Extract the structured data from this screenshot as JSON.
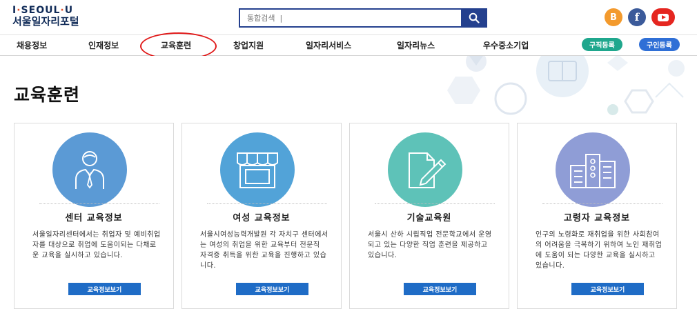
{
  "logo": {
    "line1_a": "I",
    "line1_dot1": "·",
    "line1_b": "SEOUL",
    "line1_dot2": "·",
    "line1_c": "U",
    "line2": "서울일자리포털"
  },
  "search": {
    "placeholder": "통합검색  |"
  },
  "social": {
    "blog_label": "B",
    "facebook_label": "f"
  },
  "nav": {
    "items": [
      "채용정보",
      "인재정보",
      "교육훈련",
      "창업지원",
      "일자리서비스",
      "일자리뉴스",
      "우수중소기업"
    ],
    "job_register": "구직등록",
    "hire_register": "구인등록"
  },
  "page_title": "교육훈련",
  "colors": {
    "brand_blue": "#24408e",
    "button_blue": "#1f6cc6",
    "highlight_red": "#e01a1a"
  },
  "cards": [
    {
      "title": "센터 교육정보",
      "desc": "서울일자리센터에서는 취업자 및 예비취업자를 대상으로 취업에 도움이되는 다채로운 교육을 실시하고 있습니다.",
      "button": "교육정보보기",
      "icon": "person-icon",
      "color": "#5b9ad5"
    },
    {
      "title": "여성 교육정보",
      "desc": "서울시여성능력개발원 각 자치구 센터에서는 여성의 취업을 위한 교육부터 전문직 자격증 취득을 위한 교육을 진행하고 있습니다.",
      "button": "교육정보보기",
      "icon": "shop-icon",
      "color": "#52a3d8"
    },
    {
      "title": "기술교육원",
      "desc": "서울시 산하 시립직업 전문학교에서 운영되고 있는 다양한 직업 훈련을 제공하고 있습니다.",
      "button": "교육정보보기",
      "icon": "document-pen-icon",
      "color": "#5ec2b8"
    },
    {
      "title": "고령자 교육정보",
      "desc": "인구의 노령화로 재취업을 위한 사회참여의 어려움을 극복하기 위하여 노인 재취업에 도움이 되는 다양한 교육을 실시하고 있습니다.",
      "button": "교육정보보기",
      "icon": "building-icon",
      "color": "#8f9dd6"
    }
  ]
}
